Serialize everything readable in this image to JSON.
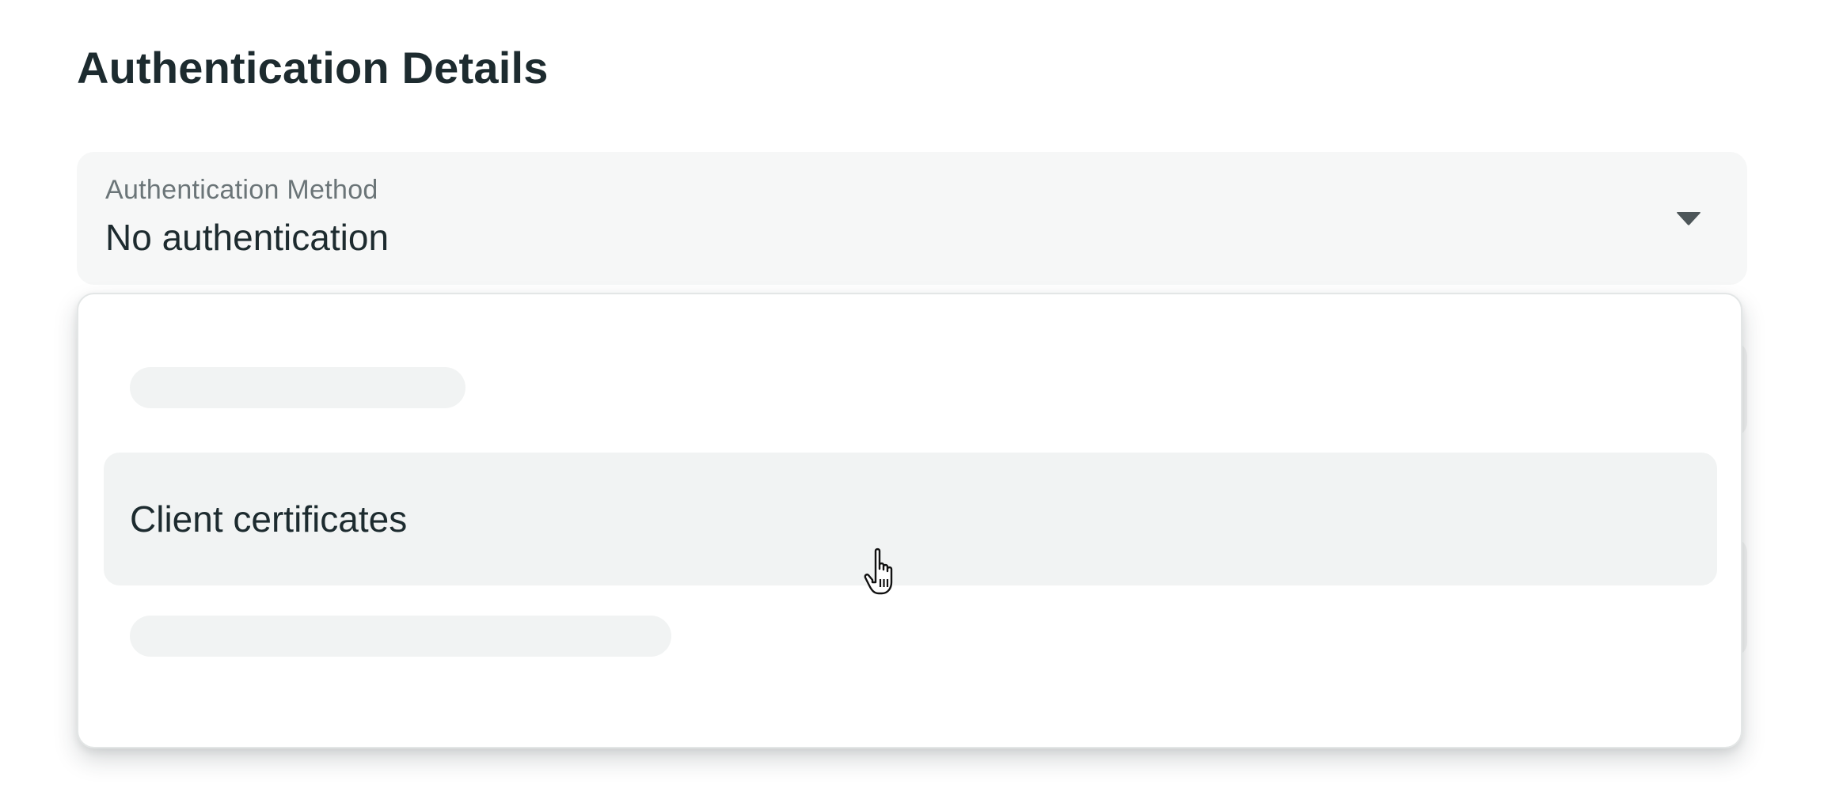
{
  "page": {
    "title": "Authentication Details"
  },
  "auth_method_select": {
    "label": "Authentication Method",
    "value": "No authentication",
    "chevron_icon": "chevron-down-icon"
  },
  "dropdown": {
    "options": [
      {
        "label": "",
        "state": "loading"
      },
      {
        "label": "Client certificates",
        "state": "hovered"
      },
      {
        "label": "",
        "state": "loading"
      }
    ]
  },
  "colors": {
    "text_primary": "#1d2b2f",
    "text_secondary": "#6b7578",
    "field_background": "#f6f7f7",
    "hover_background": "#f1f3f3"
  },
  "cursor": {
    "icon": "hand-pointer-icon"
  }
}
